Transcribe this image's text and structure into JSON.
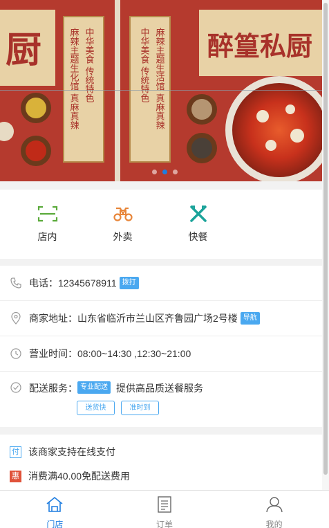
{
  "banner": {
    "left_sign": "厨",
    "right_sign": "醉篁私厨",
    "left_scroll_col1": "中华美食 传统特色",
    "left_scroll_col2": "麻辣主题生化馆 真麻真辣",
    "right_scroll_col1": "中华美食 传统特色",
    "right_scroll_col2": "麻辣主题生活馆 真麻真辣",
    "dots": 3,
    "active_dot": 1,
    "colors": {
      "bg": "#b53a2e",
      "paper": "#e8d2a6",
      "active_dot": "#1e7de0"
    }
  },
  "quick_actions": [
    {
      "label": "店内",
      "icon": "scan-icon"
    },
    {
      "label": "外卖",
      "icon": "scooter-icon"
    },
    {
      "label": "快餐",
      "icon": "fork-knife-icon"
    }
  ],
  "info": {
    "phone_label": "电话：",
    "phone_value": "12345678911",
    "phone_action": "拨打",
    "address_label": "商家地址：",
    "address_value": "山东省临沂市兰山区齐鲁园广场2号楼",
    "address_action": "导航",
    "hours_label": "营业时间：",
    "hours_value": "08:00~14:30 ,12:30~21:00",
    "delivery_label": "配送服务：",
    "delivery_tag": "专业配送",
    "delivery_desc": "提供高品质送餐服务",
    "delivery_chips": [
      "送货快",
      "准时到"
    ]
  },
  "promos": [
    {
      "badge": "付",
      "text": "该商家支持在线支付"
    },
    {
      "badge": "惠",
      "text": "消费满40.00免配送费用"
    }
  ],
  "tabs": [
    {
      "label": "门店",
      "icon": "store-icon",
      "active": true
    },
    {
      "label": "订单",
      "icon": "order-icon",
      "active": false
    },
    {
      "label": "我的",
      "icon": "user-icon",
      "active": false
    }
  ],
  "colors": {
    "accent": "#1e7de0",
    "tag_blue": "#4aa8f0",
    "promo_red": "#e0533a"
  }
}
